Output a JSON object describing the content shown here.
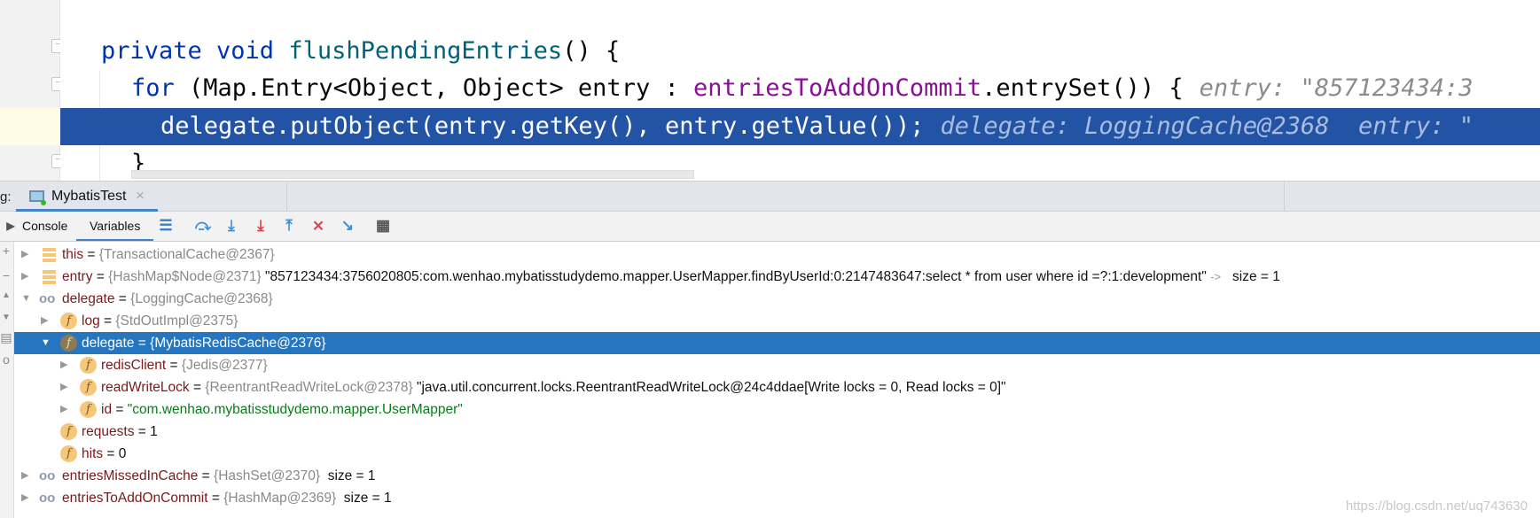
{
  "editor": {
    "lines": [
      {
        "kw": "private void ",
        "method": "flushPendingEntries",
        "rest": "() {"
      },
      {
        "kw": "for ",
        "pre": "(Map.Entry<Object, Object> entry : ",
        "field": "entriesToAddOnCommit",
        "post": ".entrySet()) {",
        "hint": "entry: \"857123434:3"
      },
      {
        "text": "delegate.putObject(entry.getKey(), entry.getValue());",
        "hint": "delegate: LoggingCache@2368  entry: \""
      },
      {
        "text": "}"
      }
    ]
  },
  "debug": {
    "label": "g:",
    "tab": "MybatisTest",
    "tab_close": "×",
    "tabs": [
      "Console",
      "Variables"
    ],
    "active_tab": "Variables",
    "toolbar_icons": [
      "layout-icon",
      "step-over-icon",
      "step-into-icon",
      "force-step-into-icon",
      "step-out-icon",
      "drop-frame-icon",
      "run-to-cursor-icon",
      "evaluate-expression-icon"
    ]
  },
  "variables": [
    {
      "depth": 0,
      "arrow": "right",
      "icon": "stack",
      "name": "this",
      "ref": "{TransactionalCache@2367}",
      "value": "",
      "extra": ""
    },
    {
      "depth": 0,
      "arrow": "right",
      "icon": "stack",
      "name": "entry",
      "ref": "{HashMap$Node@2371}",
      "value": "\"857123434:3756020805:com.wenhao.mybatisstudydemo.mapper.UserMapper.findByUserId:0:2147483647:select * from user where id =?:1:development\"",
      "arrow_sym": "->",
      "extra": "size = 1"
    },
    {
      "depth": 0,
      "arrow": "down",
      "icon": "watch",
      "name": "delegate",
      "ref": "{LoggingCache@2368}",
      "value": "",
      "extra": ""
    },
    {
      "depth": 1,
      "arrow": "right",
      "icon": "field",
      "name": "log",
      "ref": "{StdOutImpl@2375}",
      "value": "",
      "extra": ""
    },
    {
      "depth": 1,
      "arrow": "down",
      "icon": "field",
      "name": "delegate",
      "ref": "{MybatisRedisCache@2376}",
      "value": "",
      "extra": "",
      "selected": true
    },
    {
      "depth": 2,
      "arrow": "right",
      "icon": "field",
      "name": "redisClient",
      "ref": "{Jedis@2377}",
      "value": "",
      "extra": ""
    },
    {
      "depth": 2,
      "arrow": "right",
      "icon": "field",
      "name": "readWriteLock",
      "ref": "{ReentrantReadWriteLock@2378}",
      "value": "\"java.util.concurrent.locks.ReentrantReadWriteLock@24c4ddae[Write locks = 0, Read locks = 0]\"",
      "extra": ""
    },
    {
      "depth": 2,
      "arrow": "right",
      "icon": "field",
      "name": "id",
      "ref": "",
      "value": "\"com.wenhao.mybatisstudydemo.mapper.UserMapper\"",
      "value_type": "string",
      "extra": ""
    },
    {
      "depth": 1,
      "arrow": "none",
      "icon": "field",
      "name": "requests",
      "ref": "",
      "value": "1",
      "extra": ""
    },
    {
      "depth": 1,
      "arrow": "none",
      "icon": "field",
      "name": "hits",
      "ref": "",
      "value": "0",
      "extra": ""
    },
    {
      "depth": 0,
      "arrow": "right",
      "icon": "watch",
      "name": "entriesMissedInCache",
      "ref": "{HashSet@2370}",
      "value": "",
      "extra": "size = 1"
    },
    {
      "depth": 0,
      "arrow": "right",
      "icon": "watch",
      "name": "entriesToAddOnCommit",
      "ref": "{HashMap@2369}",
      "value": "",
      "extra": "size = 1"
    }
  ],
  "watermark": "https://blog.csdn.net/uq743630",
  "colors": {
    "code_highlight": "#2253a4",
    "tree_selection": "#2675bf",
    "keyword": "#0033b3",
    "field": "#871094",
    "string": "#067d17"
  }
}
